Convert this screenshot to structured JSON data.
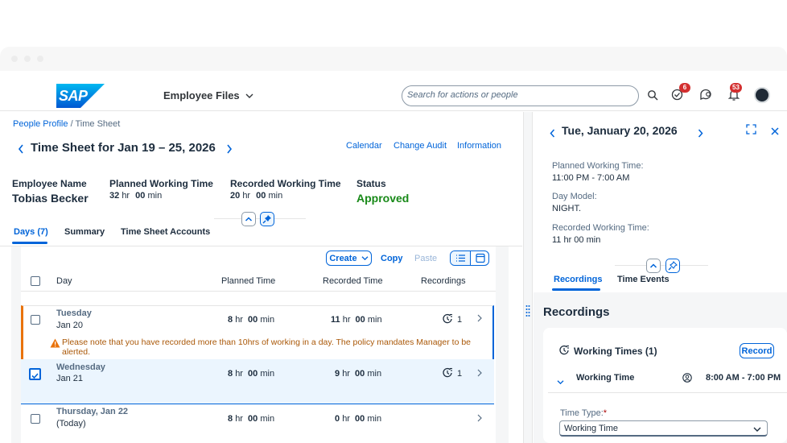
{
  "shell": {
    "logo_text": "SAP",
    "app_name": "Employee Files",
    "search_placeholder": "Search for actions or people",
    "tasks_badge": "6",
    "notifications_badge": "53"
  },
  "breadcrumb": {
    "item1": "People Profile",
    "separator": "/",
    "item2": "Time Sheet"
  },
  "page": {
    "title": "Time Sheet for Jan 19 – 25, 2026",
    "actions": [
      "Calendar",
      "Change Audit",
      "Information"
    ]
  },
  "header_info": {
    "employee_label": "Employee Name",
    "employee_value": "Tobias Becker",
    "planned_label": "Planned Working Time",
    "planned_hr": "32",
    "planned_min": "00",
    "recorded_label": "Recorded Working Time",
    "recorded_hr": "20",
    "recorded_min": "00",
    "status_label": "Status",
    "status_value": "Approved",
    "hr_unit": "hr",
    "min_unit": "min"
  },
  "tabs": [
    "Days (7)",
    "Summary",
    "Time Sheet Accounts"
  ],
  "toolbar": {
    "create": "Create",
    "copy": "Copy",
    "paste": "Paste"
  },
  "table": {
    "columns": [
      "Day",
      "Planned Time",
      "Recorded Time",
      "Recordings"
    ],
    "rows": [
      {
        "weekday": "Tuesday",
        "date": "Jan 20",
        "planned_hr": "8",
        "planned_min": "00",
        "recorded_hr": "11",
        "recorded_min": "00",
        "recordings": "1"
      },
      {
        "weekday": "Wednesday",
        "date": "Jan 21",
        "planned_hr": "8",
        "planned_min": "00",
        "recorded_hr": "9",
        "recorded_min": "00",
        "recordings": "1"
      },
      {
        "weekday": "Thursday, Jan 22",
        "date": "(Today)",
        "planned_hr": "8",
        "planned_min": "00",
        "recorded_hr": "0",
        "recorded_min": "00",
        "recordings": ""
      }
    ],
    "warning_line1": "Please note that you have recorded more than 10hrs of working in a day. The policy mandates Manager to be",
    "warning_line2": "alerted."
  },
  "detail": {
    "date_title": "Tue, January 20, 2026",
    "planned_label": "Planned Working Time:",
    "planned_value": "11:00 PM - 7:00 AM",
    "daymodel_label": "Day Model:",
    "daymodel_value": "NIGHT.",
    "recorded_label": "Recorded Working Time:",
    "recorded_value": "11 hr 00 min",
    "tabs": [
      "Recordings",
      "Time Events"
    ],
    "section_title": "Recordings",
    "card_title": "Working Times (1)",
    "record_button": "Record",
    "item_title": "Working Time",
    "item_time": "8:00 AM - 7:00 PM",
    "time_type_label": "Time Type:",
    "required_mark": "*",
    "time_type_value": "Working Time"
  },
  "colors": {
    "brand_blue": "#0064d9",
    "approved_green": "#188918",
    "warning_orange": "#aa5808",
    "badge_red": "#d32f2f"
  }
}
